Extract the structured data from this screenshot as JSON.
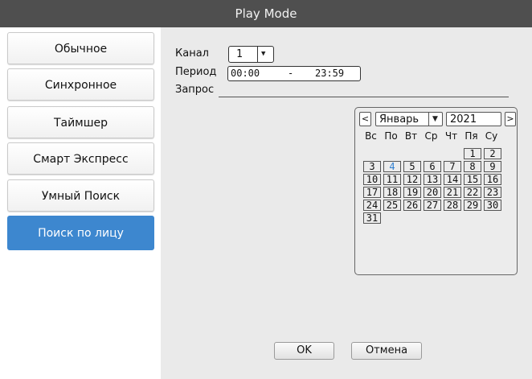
{
  "window": {
    "title": "Play Mode"
  },
  "sidebar": {
    "items": [
      {
        "label": "Обычное",
        "active": false
      },
      {
        "label": "Синхронное",
        "active": false
      },
      {
        "label": "Таймшер",
        "active": false
      },
      {
        "label": "Смарт Экспресс",
        "active": false
      },
      {
        "label": "Умный Поиск",
        "active": false
      },
      {
        "label": "Поиск по лицу",
        "active": true
      }
    ]
  },
  "form": {
    "channel_label": "Канал",
    "channel_value": "1",
    "period_label": "Период",
    "period_start": "00:00",
    "period_sep": "-",
    "period_end": "23:59",
    "query_label": "Запрос"
  },
  "calendar": {
    "prev": "<",
    "next": ">",
    "month": "Январь",
    "year": "2021",
    "weekdays": [
      "Вс",
      "По",
      "Вт",
      "Ср",
      "Чт",
      "Пя",
      "Су"
    ],
    "days": [
      "1",
      "2",
      "3",
      "4",
      "5",
      "6",
      "7",
      "8",
      "9",
      "10",
      "11",
      "12",
      "13",
      "14",
      "15",
      "16",
      "17",
      "18",
      "19",
      "20",
      "21",
      "22",
      "23",
      "24",
      "25",
      "26",
      "27",
      "28",
      "29",
      "30",
      "31"
    ],
    "today": "4",
    "accent_color": "#2f7fd1"
  },
  "footer": {
    "ok_label": "OK",
    "cancel_label": "Отмена"
  },
  "colors": {
    "titlebar": "#4f4f4f",
    "active_item": "#3d87cf",
    "panel": "#eaeaea"
  }
}
